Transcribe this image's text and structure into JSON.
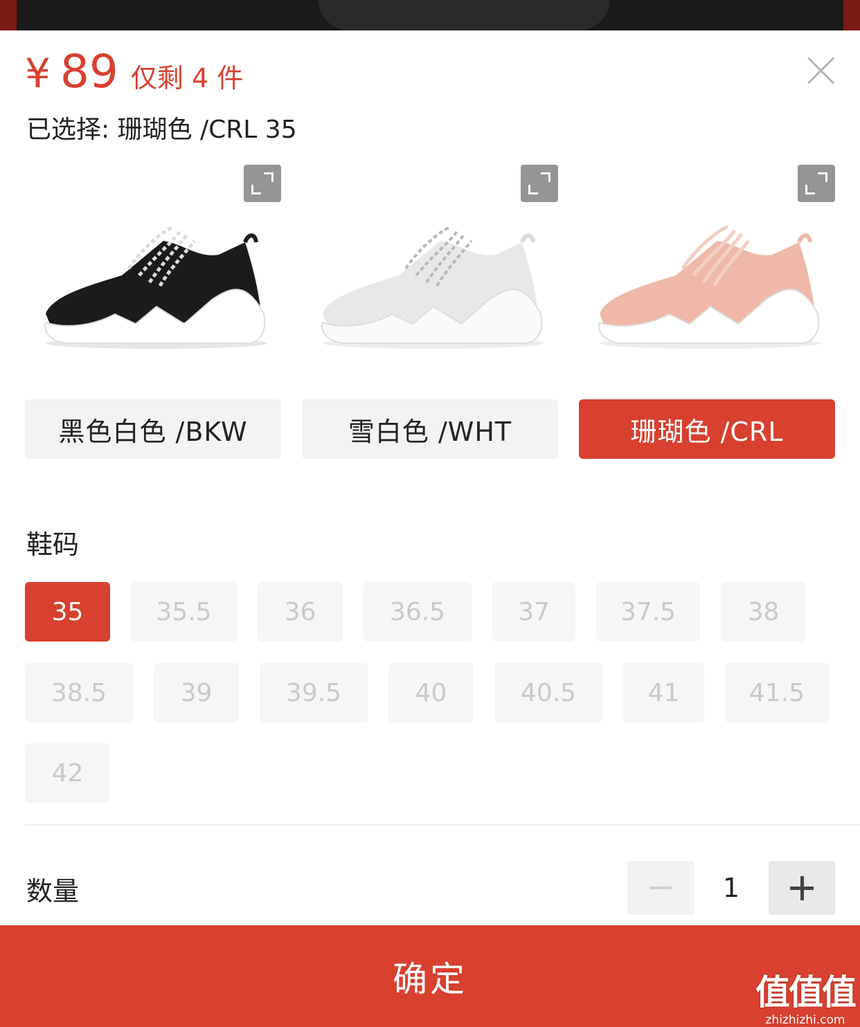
{
  "header": {
    "price_symbol": "¥",
    "price": "89",
    "stock": "仅剩 4 件",
    "selected": "已选择: 珊瑚色 /CRL 35"
  },
  "colors": [
    {
      "label": "黑色白色 /BKW",
      "upper_color": "#1b1b1b",
      "lace_color": "#dcdcdc",
      "selected": false
    },
    {
      "label": "雪白色 /WHT",
      "upper_color": "#e8e8ea",
      "lace_color": "#f7f7f7",
      "selected": false
    },
    {
      "label": "珊瑚色 /CRL",
      "upper_color": "#efb8a8",
      "lace_color": "#f3cfc4",
      "selected": true
    }
  ],
  "size_section": {
    "title": "鞋码",
    "selected": "35",
    "sizes": [
      "35",
      "35.5",
      "36",
      "36.5",
      "37",
      "37.5",
      "38",
      "38.5",
      "39",
      "39.5",
      "40",
      "40.5",
      "41",
      "41.5",
      "42"
    ]
  },
  "quantity": {
    "label": "数量",
    "value": "1"
  },
  "confirm_label": "确定",
  "watermark": {
    "brand": "值值值",
    "url": "zhizhizhi.com"
  },
  "colors_theme": {
    "accent": "#d8402f",
    "chip_bg": "#f6f6f6",
    "chip_text_disabled": "#c9c9c9"
  }
}
